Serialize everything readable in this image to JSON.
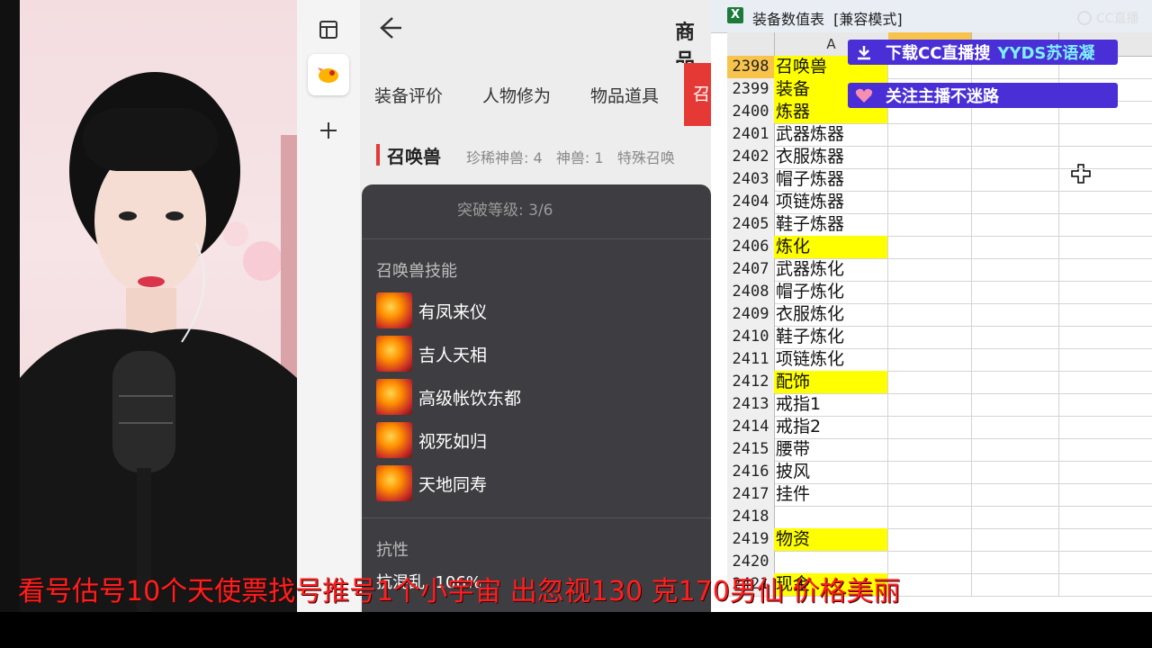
{
  "app": {
    "header_title": "商品",
    "tabs": [
      "装备评价",
      "人物修为",
      "物品道具",
      "召"
    ],
    "section_title": "召唤兽",
    "section_stats": "珍稀神兽: 4   神兽: 1   特殊召唤"
  },
  "popup": {
    "breakthrough": "突破等级: 3/6",
    "skills_header": "召唤兽技能",
    "skills": [
      "有凤来仪",
      "吉人天相",
      "高级帐饮东都",
      "视死如归",
      "天地同寿"
    ],
    "resist_header": "抗性",
    "resist_value": "抗混乱  106%"
  },
  "sheet": {
    "title": "装备数值表  [兼容模式]",
    "col_a_header": "A",
    "rows": [
      {
        "num": "2398",
        "a": "召唤兽",
        "yellow": true
      },
      {
        "num": "2399",
        "a": "装备",
        "yellow": true
      },
      {
        "num": "2400",
        "a": "炼器",
        "yellow": true
      },
      {
        "num": "2401",
        "a": "武器炼器",
        "yellow": false
      },
      {
        "num": "2402",
        "a": "衣服炼器",
        "yellow": false
      },
      {
        "num": "2403",
        "a": "帽子炼器",
        "yellow": false
      },
      {
        "num": "2404",
        "a": "项链炼器",
        "yellow": false
      },
      {
        "num": "2405",
        "a": "鞋子炼器",
        "yellow": false
      },
      {
        "num": "2406",
        "a": "炼化",
        "yellow": true
      },
      {
        "num": "2407",
        "a": "武器炼化",
        "yellow": false
      },
      {
        "num": "2408",
        "a": "帽子炼化",
        "yellow": false
      },
      {
        "num": "2409",
        "a": "衣服炼化",
        "yellow": false
      },
      {
        "num": "2410",
        "a": "鞋子炼化",
        "yellow": false
      },
      {
        "num": "2411",
        "a": "项链炼化",
        "yellow": false
      },
      {
        "num": "2412",
        "a": "配饰",
        "yellow": true
      },
      {
        "num": "2413",
        "a": "戒指1",
        "yellow": false
      },
      {
        "num": "2414",
        "a": "戒指2",
        "yellow": false
      },
      {
        "num": "2415",
        "a": "腰带",
        "yellow": false
      },
      {
        "num": "2416",
        "a": "披风",
        "yellow": false
      },
      {
        "num": "2417",
        "a": "挂件",
        "yellow": false
      },
      {
        "num": "2418",
        "a": "",
        "yellow": false
      },
      {
        "num": "2419",
        "a": "物资",
        "yellow": true
      },
      {
        "num": "2420",
        "a": "",
        "yellow": false
      },
      {
        "num": "2421",
        "a": "现金",
        "yellow": true
      }
    ]
  },
  "overlay": {
    "download_text": "下载CC直播搜",
    "download_highlight": "YYDS苏语凝",
    "follow_text": "关注主播不迷路",
    "watermark": "CC直播"
  },
  "ticker": "看号估号10个天使票找号推号1个小宇宙 出忽视130 克170男仙 价格美丽",
  "colors": {
    "accent_red": "#e53935",
    "cell_yellow": "#ffff00",
    "banner_purple": "#4a2fd6",
    "ticker_red": "#ff1f1f"
  }
}
